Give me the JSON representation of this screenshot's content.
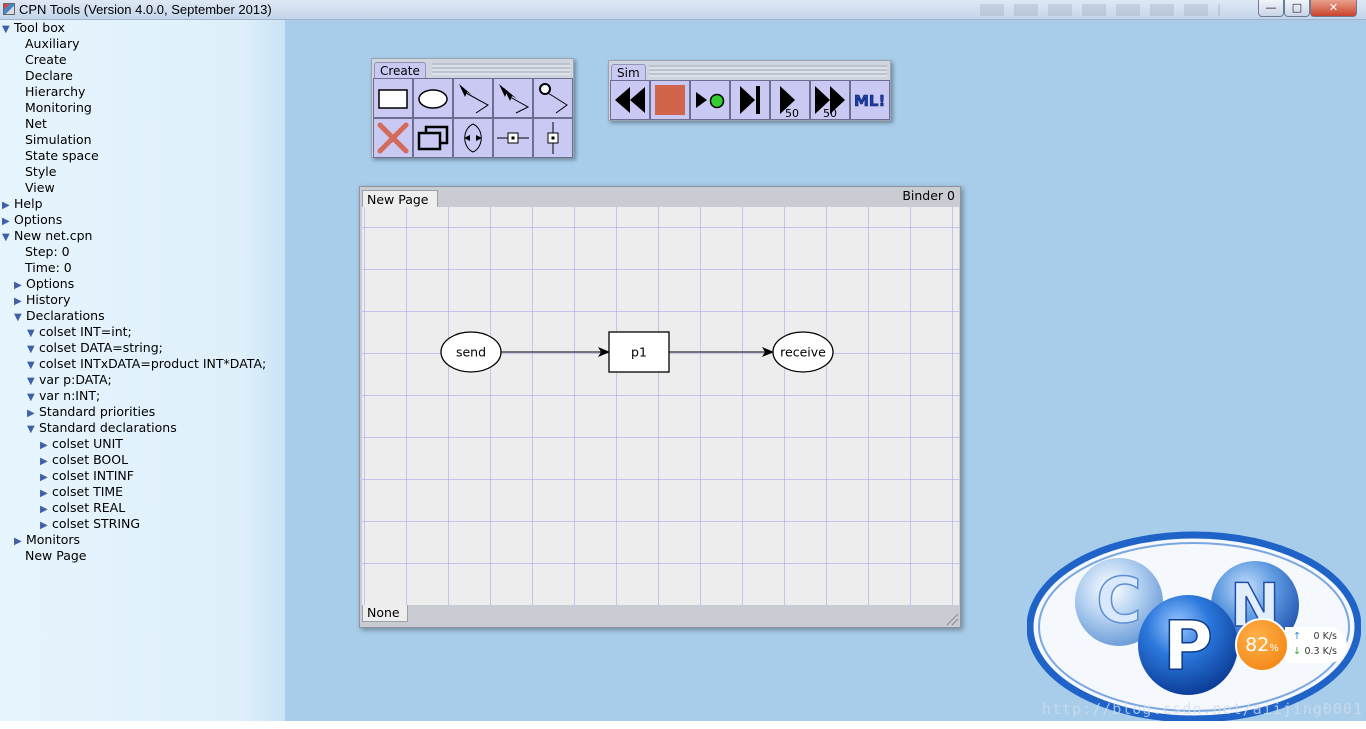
{
  "window": {
    "title": "CPN Tools (Version 4.0.0, September 2013)",
    "buttons": {
      "minimize": "—",
      "maximize": "□",
      "close": "✕"
    }
  },
  "tree": {
    "toolbox": "Tool box",
    "toolbox_items": [
      "Auxiliary",
      "Create",
      "Declare",
      "Hierarchy",
      "Monitoring",
      "Net",
      "Simulation",
      "State space",
      "Style",
      "View"
    ],
    "help": "Help",
    "options": "Options",
    "net": "New net.cpn",
    "step": "Step: 0",
    "time": "Time: 0",
    "net_options": "Options",
    "history": "History",
    "declarations": "Declarations",
    "decls": [
      "colset INT=int;",
      "colset DATA=string;",
      "colset INTxDATA=product INT*DATA;",
      "var p:DATA;",
      "var n:INT;"
    ],
    "std_priorities": "Standard priorities",
    "std_declarations": "Standard declarations",
    "std_decls": [
      "colset UNIT",
      "colset BOOL",
      "colset INTINF",
      "colset TIME",
      "colset REAL",
      "colset STRING"
    ],
    "monitors": "Monitors",
    "page": "New Page"
  },
  "create_palette": {
    "label": "Create",
    "tools": [
      "rectangle-tool",
      "ellipse-tool",
      "arc-tool",
      "double-arc-tool",
      "vertex-tool",
      "delete-tool",
      "clone-tool",
      "reverse-arc-tool",
      "horizontal-guide-tool",
      "vertical-guide-tool"
    ]
  },
  "sim_palette": {
    "label": "Sim",
    "tools": [
      "rewind-tool",
      "stop-tool",
      "play-single-tool",
      "step-tool",
      "play-n-tool",
      "fast-forward-tool",
      "ml-evaluate-tool"
    ],
    "play_count": "50",
    "ff_count": "50",
    "ml_label": "ML!"
  },
  "binder": {
    "title": "Binder 0",
    "tab": "New Page",
    "status": "None",
    "net": {
      "places": [
        "send",
        "receive"
      ],
      "transition": "p1"
    }
  },
  "logo": {
    "letters": [
      "C",
      "P",
      "N"
    ],
    "watermark": "http://blog.csdn.net/aiijing0001"
  },
  "net_widget": {
    "percent": "82",
    "percent_sign": "%",
    "up_rate": "0 K/s",
    "down_rate": "0.3 K/s"
  },
  "colors": {
    "workspace": "#a8cdea",
    "tool_bg": "#c9c9f4",
    "delete_red": "#d46a5a",
    "stop_red": "#d0654b",
    "play_green": "#33cc33",
    "logo_blue": "#1f63c8",
    "badge_orange": "#f07d0a"
  }
}
